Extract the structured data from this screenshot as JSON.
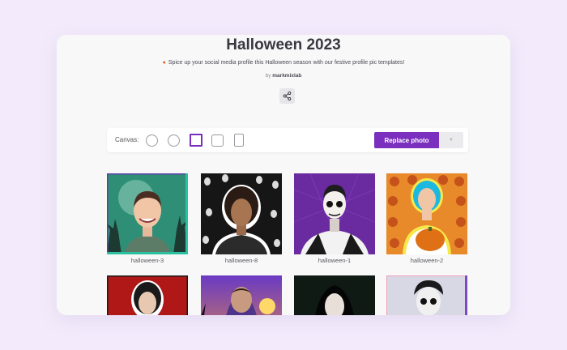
{
  "page": {
    "title": "Halloween 2023",
    "subtitle": "Spice up your social media profile this Halloween season with our festive profile pic templates!",
    "by_prefix": "by",
    "author": "markmixlab"
  },
  "toolbar": {
    "canvas_label": "Canvas:",
    "replace_label": "Replace photo",
    "dropdown_icon": "chevron-down-icon",
    "selected_shape": "rounded-square"
  },
  "templates": [
    {
      "name": "halloween-3"
    },
    {
      "name": "halloween-8"
    },
    {
      "name": "halloween-1"
    },
    {
      "name": "halloween-2"
    },
    {
      "name": ""
    },
    {
      "name": ""
    },
    {
      "name": ""
    },
    {
      "name": ""
    }
  ],
  "colors": {
    "accent": "#7b2fbe",
    "page_background": "#f3ebfb",
    "card_background": "#f8f8f8"
  }
}
